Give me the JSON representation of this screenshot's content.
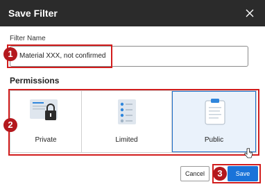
{
  "dialog": {
    "title": "Save Filter",
    "close_icon": "close-icon"
  },
  "filter_name": {
    "label": "Filter Name",
    "value": "Material XXX, not confirmed"
  },
  "permissions": {
    "label": "Permissions",
    "options": [
      {
        "label": "Private",
        "icon": "lock-document-icon",
        "selected": false
      },
      {
        "label": "Limited",
        "icon": "checklist-icon",
        "selected": false
      },
      {
        "label": "Public",
        "icon": "clipboard-icon",
        "selected": true
      }
    ]
  },
  "buttons": {
    "cancel": "Cancel",
    "save": "Save"
  },
  "annotations": {
    "step1": "1",
    "step2": "2",
    "step3": "3",
    "highlight_color": "#d21c1c",
    "badge_color": "#b4181d"
  },
  "colors": {
    "titlebar": "#2b2b2b",
    "accent": "#1a73d9",
    "selected_bg": "#eaf2fb"
  }
}
